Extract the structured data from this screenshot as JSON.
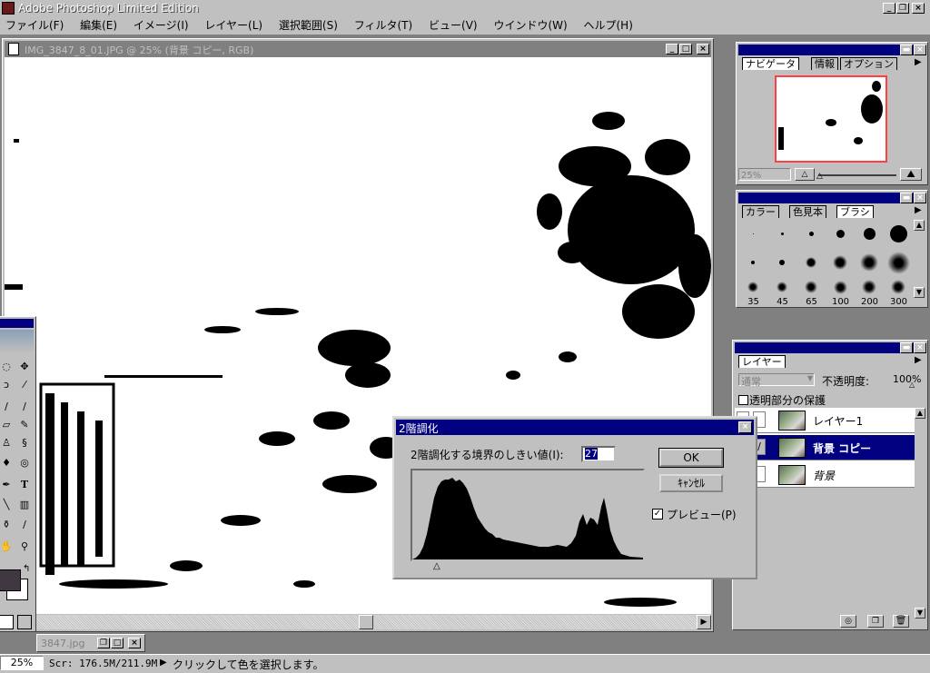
{
  "app": {
    "title": "Adobe Photoshop Limited Edition"
  },
  "menu": [
    "ファイル(F)",
    "編集(E)",
    "イメージ(I)",
    "レイヤー(L)",
    "選択範囲(S)",
    "フィルタ(T)",
    "ビュー(V)",
    "ウインドウ(W)",
    "ヘルプ(H)"
  ],
  "document": {
    "title": "IMG_3847_8_01.JPG @ 25% (背景 コピー, RGB)"
  },
  "minimized_doc": {
    "title": "3847.jpg"
  },
  "navigator": {
    "tabs": [
      "ナビゲータ",
      "情報",
      "オプション"
    ],
    "zoom": "25%"
  },
  "swatches": {
    "tabs": [
      "カラー",
      "色見本",
      "ブラシ"
    ],
    "brush_sizes": [
      "35",
      "45",
      "65",
      "100",
      "200",
      "300"
    ]
  },
  "layers": {
    "tab": "レイヤー",
    "blend_mode": "通常",
    "opacity_label": "不透明度:",
    "opacity_value": "100%",
    "preserve_label": "透明部分の保護",
    "items": [
      {
        "name": "レイヤー1",
        "selected": false
      },
      {
        "name": "背景 コピー",
        "selected": true
      },
      {
        "name": "背景",
        "selected": false
      }
    ]
  },
  "dialog": {
    "title": "2階調化",
    "threshold_label": "2階調化する境界のしきい値(I):",
    "threshold_value": "27",
    "ok": "OK",
    "cancel": "ｷｬﾝｾﾙ",
    "preview_label": "プレビュー(P)",
    "preview_checked": true,
    "marker_fraction": 0.11
  },
  "status": {
    "zoom": "25%",
    "scratch": "Scr: 176.5M/211.9M",
    "message": "クリックして色を選択します。"
  },
  "colors": {
    "titlebar": "#000080",
    "panel": "#c0c0c0",
    "foreground": "#403840"
  }
}
